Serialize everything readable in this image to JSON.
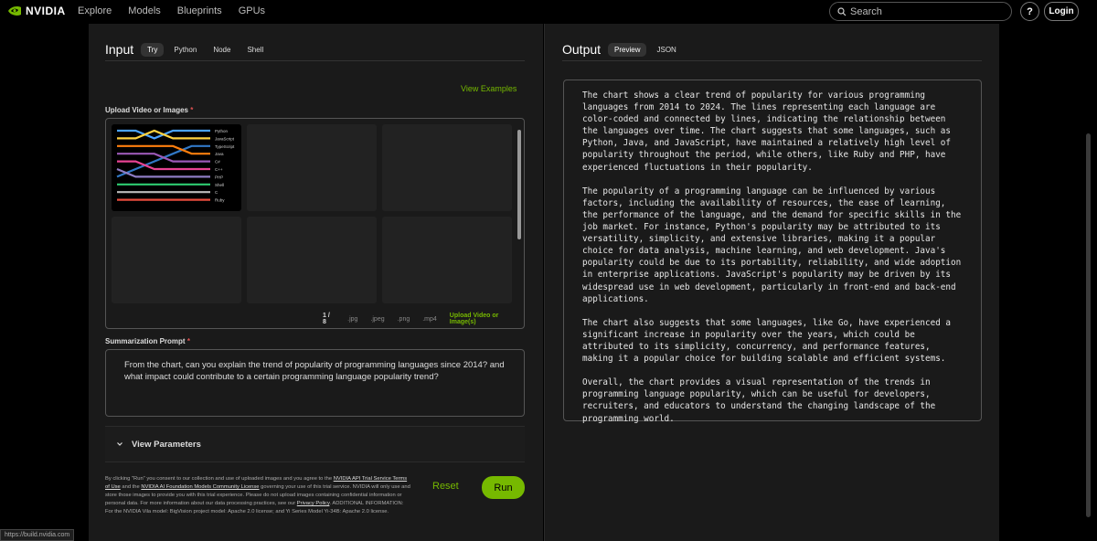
{
  "nav": {
    "brand": "NVIDIA",
    "links": [
      "Explore",
      "Models",
      "Blueprints",
      "GPUs"
    ],
    "search_placeholder": "Search",
    "help": "?",
    "login": "Login"
  },
  "input": {
    "title": "Input",
    "tabs": [
      "Try",
      "Python",
      "Node",
      "Shell"
    ],
    "active_tab": 0,
    "view_examples": "View Examples",
    "upload_label": "Upload Video or Images",
    "required_mark": "*",
    "page_count": "1 / 8",
    "formats": [
      ".jpg",
      ".jpeg",
      ".png",
      ".mp4"
    ],
    "upload_button": "Upload Video or Image(s)",
    "prompt_label": "Summarization Prompt",
    "prompt_text": "From the chart, can you explain the trend of popularity of programming languages since 2014? and what impact could contribute to a certain programming language popularity trend?",
    "params_label": "View Parameters",
    "reset": "Reset",
    "run": "Run",
    "legal": {
      "p1": "By clicking \"Run\" you consent to our collection and use of uploaded images and you agree to the ",
      "l1": "NVIDIA API Trial Service Terms of Use",
      "p2": " and the ",
      "l2": "NVIDIA AI Foundation Models Community License",
      "p3": " governing your use of this trial service. NVIDIA will only use and store those images to provide you with this trial experience. Please do not upload images containing confidential information or personal data. For more information about our data processing practices, see our ",
      "l3": "Privacy Policy",
      "p4": ". ADDITIONAL INFORMATION: For the NVIDIA Vila model: BigVision project model: Apache 2.0 license; and Yi Series Model Yi-34B: Apache 2.0 license."
    }
  },
  "thumbnail": {
    "legend": [
      "Python",
      "JavaScript",
      "TypeScript",
      "Java",
      "C#",
      "C++",
      "PHP",
      "Shell",
      "C",
      "Ruby"
    ],
    "colors": [
      "#4aa3ff",
      "#ffd23f",
      "#3178c6",
      "#ff7f0e",
      "#9b59b6",
      "#e84393",
      "#8e7cc3",
      "#2ecc71",
      "#bbbbbb",
      "#e74c3c"
    ]
  },
  "output": {
    "title": "Output",
    "tabs": [
      "Preview",
      "JSON"
    ],
    "active_tab": 0,
    "paragraphs": [
      "The chart shows a clear trend of popularity for various programming languages from 2014 to 2024. The lines representing each language are color-coded and connected by lines, indicating the relationship between the languages over time. The chart suggests that some languages, such as Python, Java, and JavaScript, have maintained a relatively high level of popularity throughout the period, while others, like Ruby and PHP, have experienced fluctuations in their popularity.",
      "The popularity of a programming language can be influenced by various factors, including the availability of resources, the ease of learning, the performance of the language, and the demand for specific skills in the job market. For instance, Python's popularity may be attributed to its versatility, simplicity, and extensive libraries, making it a popular choice for data analysis, machine learning, and web development. Java's popularity could be due to its portability, reliability, and wide adoption in enterprise applications. JavaScript's popularity may be driven by its widespread use in web development, particularly in front-end and back-end applications.",
      "The chart also suggests that some languages, like Go, have experienced a significant increase in popularity over the years, which could be attributed to its simplicity, concurrency, and performance features, making it a popular choice for building scalable and efficient systems.",
      "Overall, the chart provides a visual representation of the trends in programming language popularity, which can be useful for developers, recruiters, and educators to understand the changing landscape of the programming world."
    ]
  },
  "status_url": "https://build.nvidia.com"
}
